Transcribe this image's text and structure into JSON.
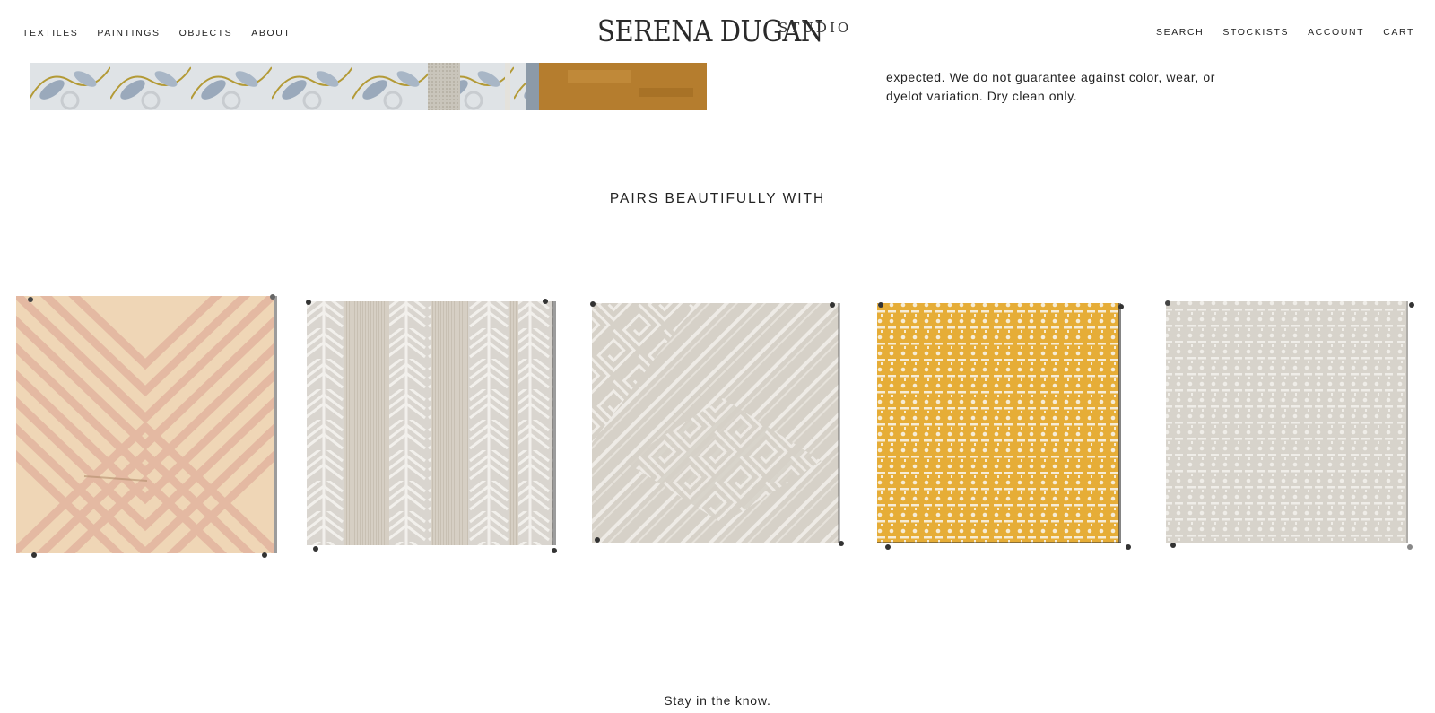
{
  "header": {
    "logo_main": "SERENA DUGAN",
    "logo_sub": "STUDIO",
    "nav_left": [
      "TEXTILES",
      "PAINTINGS",
      "OBJECTS",
      "ABOUT"
    ],
    "nav_right": [
      "SEARCH",
      "STOCKISTS",
      "ACCOUNT",
      "CART"
    ]
  },
  "product": {
    "description_line1": "expected. We do not guarantee against color, wear, or",
    "description_line2": "dyelot variation. Dry clean only."
  },
  "pairs": {
    "title": "PAIRS BEAUTIFULLY WITH",
    "items": [
      {
        "pattern": "chevron-diamond",
        "color": "#e8c9a8"
      },
      {
        "pattern": "feather-stripe",
        "color": "#d9d4cc"
      },
      {
        "pattern": "greek-lattice",
        "color": "#d8d3cb"
      },
      {
        "pattern": "dash-dot-weave",
        "color": "#e5ae3a"
      },
      {
        "pattern": "dash-dot-weave",
        "color": "#d6d3cb"
      }
    ]
  },
  "footer": {
    "newsletter_heading": "Stay in the know."
  }
}
